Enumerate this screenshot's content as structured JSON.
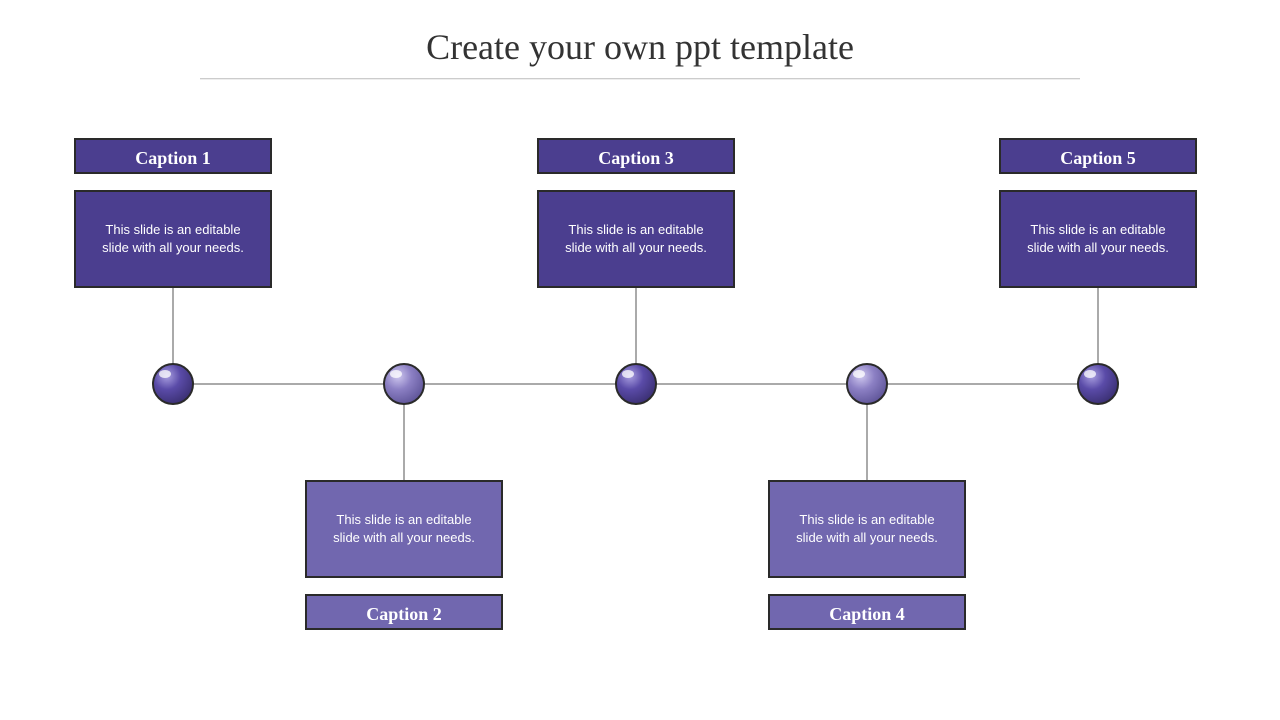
{
  "title": "Create your own ppt template",
  "nodes": {
    "n1": {
      "caption": "Caption 1",
      "desc": "This slide is an editable slide with all your needs."
    },
    "n2": {
      "caption": "Caption 2",
      "desc": "This slide is an editable slide with all your needs."
    },
    "n3": {
      "caption": "Caption 3",
      "desc": "This slide is an editable slide with all your needs."
    },
    "n4": {
      "caption": "Caption 4",
      "desc": "This slide is an editable slide with all your needs."
    },
    "n5": {
      "caption": "Caption 5",
      "desc": "This slide is an editable slide with all your needs."
    }
  },
  "colors": {
    "dark": "#4b3e8f",
    "light": "#7167af"
  }
}
